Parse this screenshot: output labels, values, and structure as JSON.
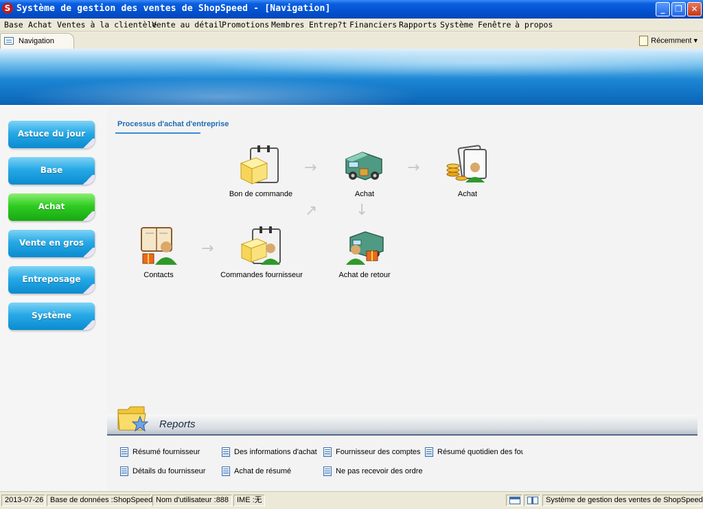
{
  "window": {
    "title": "Système de gestion des ventes de ShopSpeed - [Navigation]",
    "app_icon_glyph": "S",
    "controls": {
      "minimize": "_",
      "restore": "❐",
      "close": "✕"
    }
  },
  "menu": [
    "Base",
    "Achat",
    "Ventes à la clientèle",
    "Vente au détail",
    "Promotions",
    "Membres",
    "Entrep?t",
    "Financiers",
    "Rapports",
    "Système",
    "Fenêtre",
    "à propos"
  ],
  "tabs": {
    "active": "Navigation",
    "recent": "Récemment ▾"
  },
  "sidebar": {
    "items": [
      {
        "label": "Astuce du jour",
        "active": false
      },
      {
        "label": "Base",
        "active": false
      },
      {
        "label": "Achat",
        "active": true
      },
      {
        "label": "Vente en gros",
        "active": false
      },
      {
        "label": "Entreposage",
        "active": false
      },
      {
        "label": "Système",
        "active": false
      }
    ]
  },
  "process": {
    "title": "Processus d'achat d'entreprise",
    "nodes": {
      "bon_commande": "Bon de commande",
      "achat": "Achat",
      "achat_paiement": "Achat",
      "contacts": "Contacts",
      "commandes_fournisseur": "Commandes fournisseur",
      "achat_retour": "Achat de retour"
    },
    "arrow_glyphs": {
      "right": "→",
      "down": "↓",
      "diag": "↗"
    }
  },
  "reports": {
    "title": "Reports",
    "links": [
      "Résumé fournisseur",
      "Des informations d'achat",
      "Fournisseur des comptes fournisseurs",
      "Résumé quotidien des fournisseurs",
      "Détails du fournisseur",
      "Achat de résumé",
      "Ne pas recevoir des ordre"
    ]
  },
  "status": {
    "date": "2013-07-26",
    "database": "Base de données :ShopSpeed",
    "user": "Nom d'utilisateur :888",
    "ime": "IME :无",
    "app": "Système de gestion des ventes de ShopSpeed"
  },
  "colors": {
    "title_bar": "#0452d0",
    "accent_blue": "#1e6cb3",
    "nav_blue": "#0b8bd0",
    "nav_active_green": "#2fcc22"
  }
}
